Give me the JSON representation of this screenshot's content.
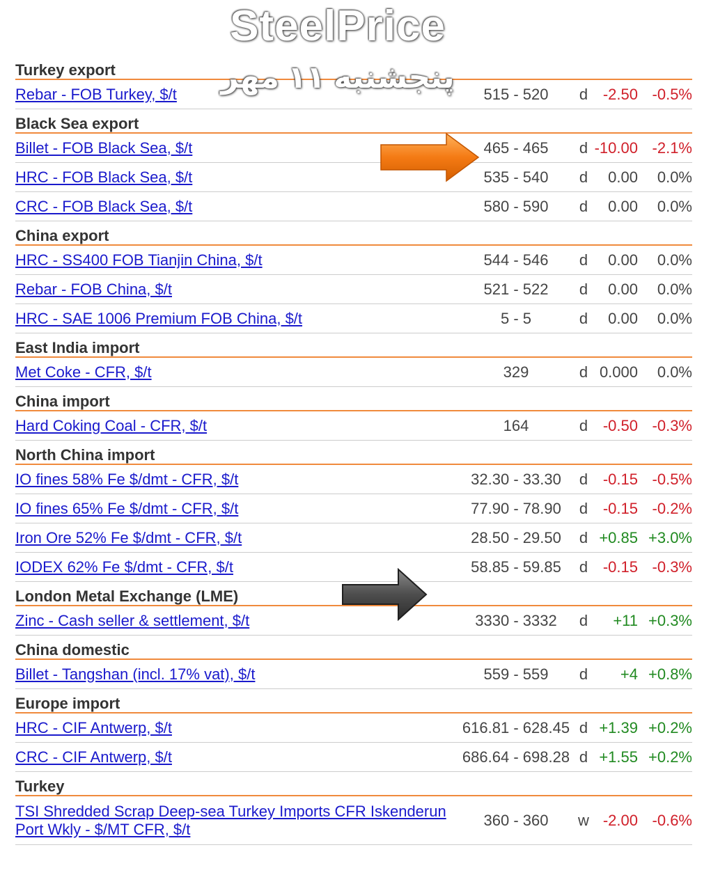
{
  "watermark": {
    "title": "SteelPrice",
    "subtitle": "پنجشنبه ۱۱ مهر"
  },
  "colors": {
    "accent_line": "#f08a3c",
    "link": "#1a1acc",
    "negative": "#d0202a",
    "positive": "#218a21"
  },
  "sections": [
    {
      "title": "Turkey export",
      "rows": [
        {
          "name": "Rebar - FOB Turkey, $/t",
          "range": "515 - 520",
          "period": "d",
          "change": "-2.50",
          "pct": "-0.5%",
          "trend": "neg"
        }
      ]
    },
    {
      "title": "Black Sea export",
      "rows": [
        {
          "name": "Billet - FOB Black Sea, $/t",
          "range": "465 - 465",
          "period": "d",
          "change": "-10.00",
          "pct": "-2.1%",
          "trend": "neg"
        },
        {
          "name": "HRC - FOB Black Sea, $/t",
          "range": "535 - 540",
          "period": "d",
          "change": "0.00",
          "pct": "0.0%",
          "trend": "neutral"
        },
        {
          "name": "CRC - FOB Black Sea, $/t",
          "range": "580 - 590",
          "period": "d",
          "change": "0.00",
          "pct": "0.0%",
          "trend": "neutral"
        }
      ]
    },
    {
      "title": "China export",
      "rows": [
        {
          "name": "HRC - SS400 FOB Tianjin China, $/t",
          "range": "544 - 546",
          "period": "d",
          "change": "0.00",
          "pct": "0.0%",
          "trend": "neutral"
        },
        {
          "name": "Rebar - FOB China, $/t",
          "range": "521 - 522",
          "period": "d",
          "change": "0.00",
          "pct": "0.0%",
          "trend": "neutral"
        },
        {
          "name": "HRC - SAE 1006 Premium FOB China, $/t",
          "range": "5 - 5",
          "period": "d",
          "change": "0.00",
          "pct": "0.0%",
          "trend": "neutral"
        }
      ]
    },
    {
      "title": "East India import",
      "rows": [
        {
          "name": "Met Coke - CFR, $/t",
          "range": "329",
          "period": "d",
          "change": "0.000",
          "pct": "0.0%",
          "trend": "neutral"
        }
      ]
    },
    {
      "title": "China import",
      "rows": [
        {
          "name": "Hard Coking Coal - CFR, $/t",
          "range": "164",
          "period": "d",
          "change": "-0.50",
          "pct": "-0.3%",
          "trend": "neg"
        }
      ]
    },
    {
      "title": "North China import",
      "rows": [
        {
          "name": "IO fines 58% Fe $/dmt - CFR, $/t",
          "range": "32.30 - 33.30",
          "period": "d",
          "change": "-0.15",
          "pct": "-0.5%",
          "trend": "neg"
        },
        {
          "name": "IO fines 65% Fe $/dmt - CFR, $/t",
          "range": "77.90 - 78.90",
          "period": "d",
          "change": "-0.15",
          "pct": "-0.2%",
          "trend": "neg"
        },
        {
          "name": "Iron Ore 52% Fe $/dmt - CFR, $/t",
          "range": "28.50 - 29.50",
          "period": "d",
          "change": "+0.85",
          "pct": "+3.0%",
          "trend": "pos"
        },
        {
          "name": "IODEX 62% Fe $/dmt - CFR, $/t",
          "range": "58.85 - 59.85",
          "period": "d",
          "change": "-0.15",
          "pct": "-0.3%",
          "trend": "neg"
        }
      ]
    },
    {
      "title": "London Metal Exchange (LME)",
      "rows": [
        {
          "name": "Zinc - Cash seller & settlement, $/t",
          "range": "3330 - 3332",
          "period": "d",
          "change": "+11",
          "pct": "+0.3%",
          "trend": "pos"
        }
      ]
    },
    {
      "title": "China domestic",
      "rows": [
        {
          "name": "Billet - Tangshan (incl. 17% vat), $/t",
          "range": "559 - 559",
          "period": "d",
          "change": "+4",
          "pct": "+0.8%",
          "trend": "pos"
        }
      ]
    },
    {
      "title": "Europe import",
      "rows": [
        {
          "name": "HRC - CIF Antwerp, $/t",
          "range": "616.81 - 628.45",
          "period": "d",
          "change": "+1.39",
          "pct": "+0.2%",
          "trend": "pos"
        },
        {
          "name": "CRC - CIF Antwerp, $/t",
          "range": "686.64 - 698.28",
          "period": "d",
          "change": "+1.55",
          "pct": "+0.2%",
          "trend": "pos"
        }
      ]
    },
    {
      "title": "Turkey",
      "rows": [
        {
          "name": "TSI Shredded Scrap Deep-sea Turkey Imports CFR Iskenderun Port Wkly - $/MT CFR, $/t",
          "range": "360 - 360",
          "period": "w",
          "change": "-2.00",
          "pct": "-0.6%",
          "trend": "neg",
          "tall": true
        }
      ]
    }
  ]
}
